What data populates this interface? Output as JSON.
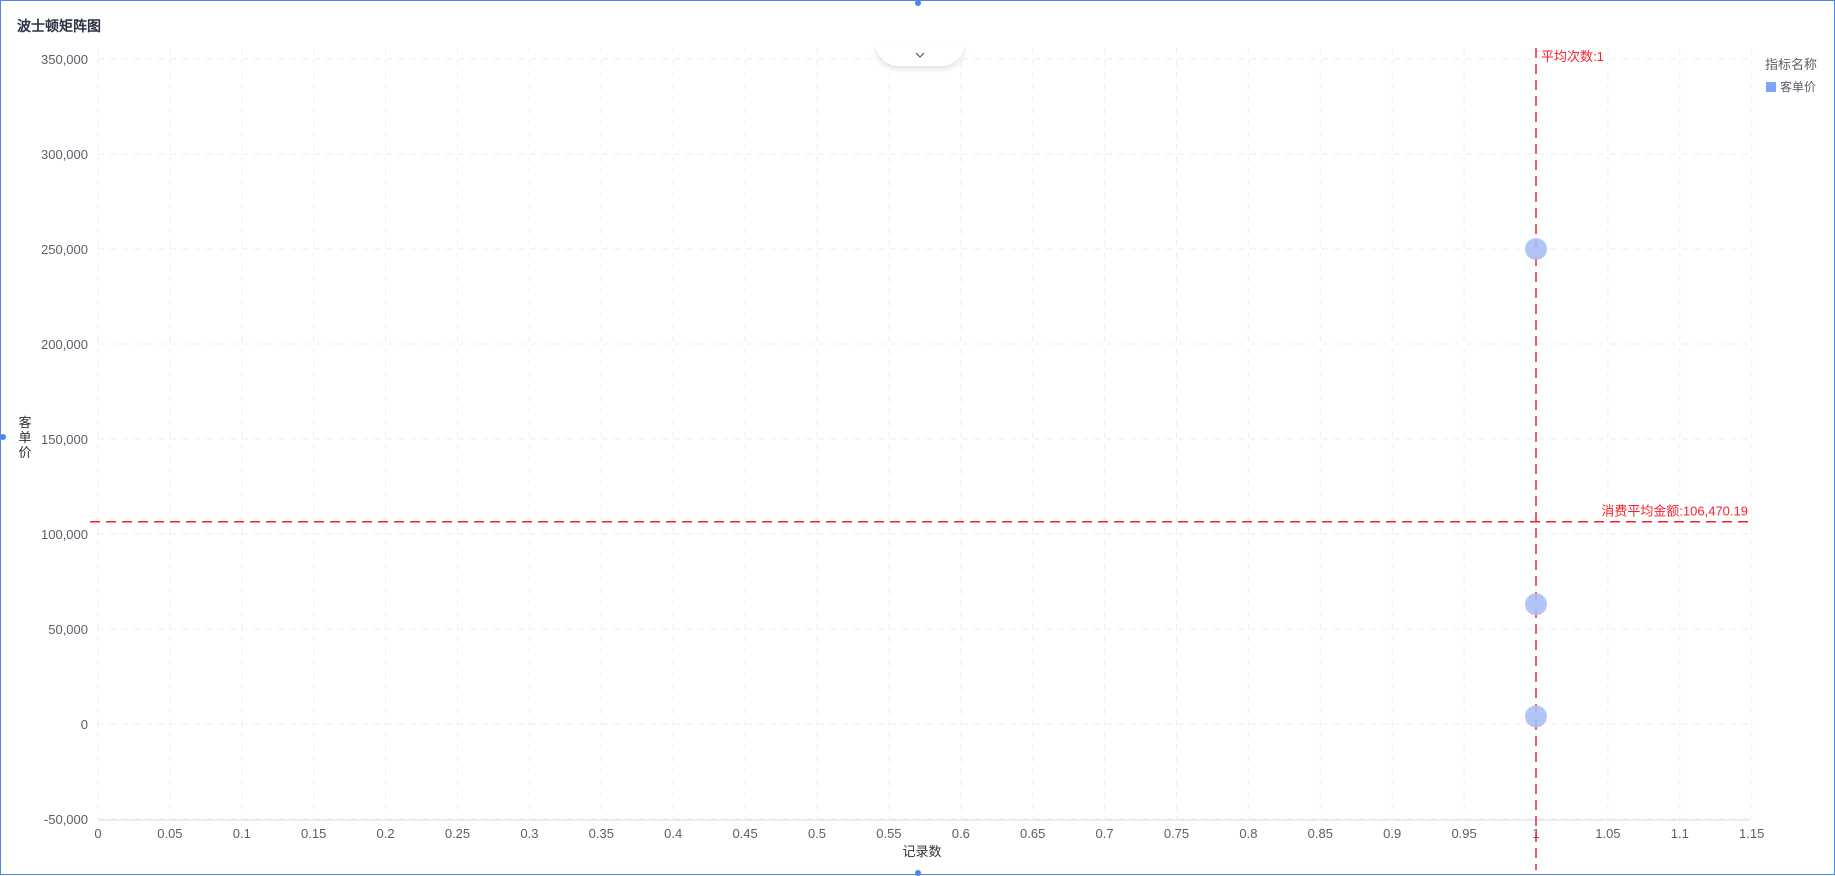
{
  "title": "波士顿矩阵图",
  "legend": {
    "title": "指标名称",
    "items": [
      {
        "label": "客单价",
        "color": "#5b8ff9"
      }
    ]
  },
  "colors": {
    "accent": "#4a86e8",
    "ref_line": "#f5222d",
    "point": "#a9bff5"
  },
  "icons": {
    "collapse": "chevron-down-icon"
  },
  "chart_data": {
    "type": "scatter",
    "title": "波士顿矩阵图",
    "xlabel": "记录数",
    "ylabel": "客单价",
    "xlim": [
      0,
      1.15
    ],
    "ylim": [
      -50000,
      350000
    ],
    "x_ticks": [
      "0",
      "0.05",
      "0.1",
      "0.15",
      "0.2",
      "0.25",
      "0.3",
      "0.35",
      "0.4",
      "0.45",
      "0.5",
      "0.55",
      "0.6",
      "0.65",
      "0.7",
      "0.75",
      "0.8",
      "0.85",
      "0.9",
      "0.95",
      "1",
      "1.05",
      "1.1",
      "1.15"
    ],
    "y_ticks": [
      "-50,000",
      "0",
      "50,000",
      "100,000",
      "150,000",
      "200,000",
      "250,000",
      "300,000",
      "350,000"
    ],
    "series": [
      {
        "name": "客单价",
        "points": [
          {
            "x": 1,
            "y": 250000
          },
          {
            "x": 1,
            "y": 63000
          },
          {
            "x": 1,
            "y": 4000
          }
        ]
      }
    ],
    "reference_lines": [
      {
        "axis": "x",
        "value": 1,
        "label": "平均次数:1"
      },
      {
        "axis": "y",
        "value": 106470.19,
        "label": "消费平均金额:106,470.19"
      }
    ],
    "grid": true,
    "legend_position": "top-right"
  }
}
